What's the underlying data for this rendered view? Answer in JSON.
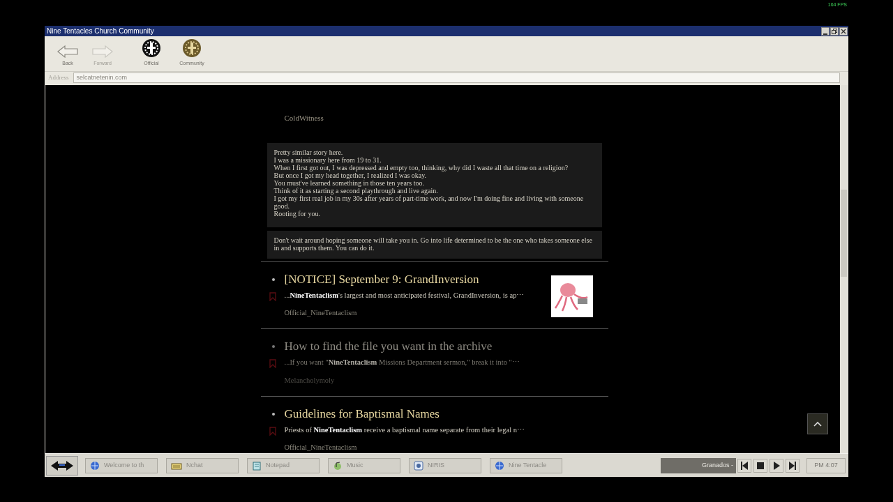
{
  "overlay": {
    "fps": "164 FPS"
  },
  "window": {
    "title": "Nine Tentacles Church Community"
  },
  "toolbar": {
    "buttons": [
      {
        "label": "Back",
        "kind": "back",
        "disabled": false
      },
      {
        "label": "Forward",
        "kind": "forward",
        "disabled": true
      },
      {
        "label": "Official",
        "kind": "official",
        "disabled": false
      },
      {
        "label": "Community",
        "kind": "community",
        "disabled": false
      }
    ]
  },
  "address": {
    "label": "Address",
    "value": "selcatnetenin.com"
  },
  "thread": {
    "author": "ColdWitness",
    "comments": [
      {
        "lines": [
          "Pretty similar story here.",
          "I was a missionary here from 19 to 31.",
          "When I first got out, I was depressed and empty too, thinking, why did I waste all that time on a religion?",
          "But once I got my head together, I realized I was okay.",
          "You must've learned something in those ten years too.",
          "Think of it as starting a second playthrough and live again.",
          "I got my first real job in my 30s after years of part-time work, and now I'm doing fine and living with someone good.",
          "Rooting for you."
        ]
      },
      {
        "lines": [
          "Don't wait around hoping someone will take you in. Go into life determined to be the one who takes someone else in and supports them. You can do it."
        ]
      }
    ]
  },
  "posts": [
    {
      "title": "[NOTICE] September 9: GrandInversion",
      "snippet": "...**NineTentaclism**'s largest and most anticipated festival, GrandInversion, is ap⋯",
      "author": "Official_NineTentaclism",
      "dimmed": false,
      "thumbnail": true
    },
    {
      "title": "How to find the file you want in the archive",
      "snippet": "...If you want \"**NineTentaclism** Missions Department sermon,\" break it into \"⋯",
      "author": "Melancholymoly",
      "dimmed": true,
      "thumbnail": false
    },
    {
      "title": "Guidelines for Baptismal Names",
      "snippet": "Priests of **NineTentaclism** receive a baptismal name separate from their legal n⋯",
      "author": "Official_NineTentaclism",
      "dimmed": false,
      "thumbnail": false
    }
  ],
  "taskbar": {
    "items": [
      {
        "label": "Welcome to th",
        "kind": "browser"
      },
      {
        "label": "Nchat",
        "kind": "chat"
      },
      {
        "label": "Notepad",
        "kind": "notepad"
      },
      {
        "label": "Music",
        "kind": "music"
      },
      {
        "label": "NIRIS",
        "kind": "niris"
      },
      {
        "label": "Nine Tentacle",
        "kind": "browser"
      }
    ],
    "player": {
      "track": "Granados - ",
      "controls": [
        {
          "kind": "prev"
        },
        {
          "kind": "stop"
        },
        {
          "kind": "play"
        },
        {
          "kind": "next"
        }
      ]
    },
    "clock": "PM 4:07"
  }
}
